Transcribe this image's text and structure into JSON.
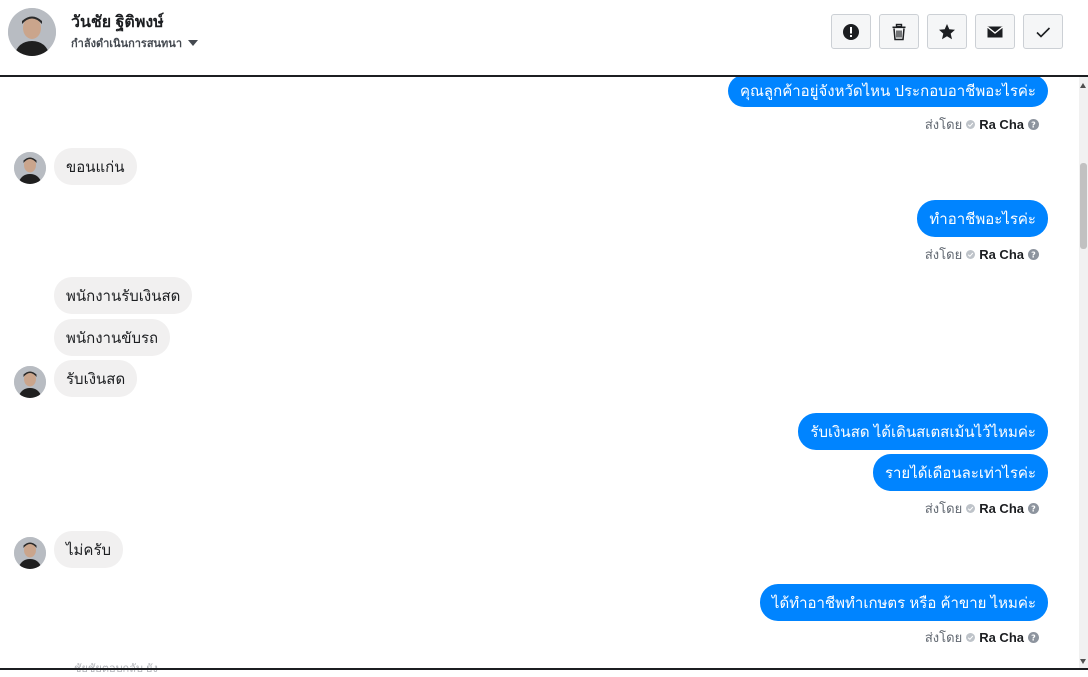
{
  "contact": {
    "name": "วันชัย ฐิติพงษ์",
    "status_label": "กำลังดำเนินการสนทนา"
  },
  "actions": [
    {
      "name": "report-icon",
      "kind": "report"
    },
    {
      "name": "trash-icon",
      "kind": "delete"
    },
    {
      "name": "star-icon",
      "kind": "star"
    },
    {
      "name": "envelope-icon",
      "kind": "mail"
    },
    {
      "name": "checkmark-icon",
      "kind": "done"
    }
  ],
  "sent_by": {
    "prefix": "ส่งโดย",
    "agent": "Ra Cha"
  },
  "messages": {
    "m1_out": "คุณลูกค้าอยู่จังหวัดไหน ประกอบอาชีพอะไรค่ะ",
    "m2_in": "ขอนแก่น",
    "m3_out": "ทำอาชีพอะไรค่ะ",
    "m4_in": "พนักงานรับเงินสด",
    "m5_in": "พนักงานขับรถ",
    "m6_in": "รับเงินสด",
    "m7_out": "รับเงินสด ได้เดินสเตสเม้นไว้ไหมค่ะ",
    "m8_out": "รายได้เดือนละเท่าไรค่ะ",
    "m9_in": "ไม่ครับ",
    "m10_out": "ได้ทำอาชีพทำเกษตร หรือ ค้าขาย ไหมค่ะ",
    "peek": "ชัยชัยตอบกลับ ยัง"
  },
  "colors": {
    "outgoing": "#0084ff",
    "incoming": "#f1f0f0",
    "divider": "#1c1e21"
  }
}
